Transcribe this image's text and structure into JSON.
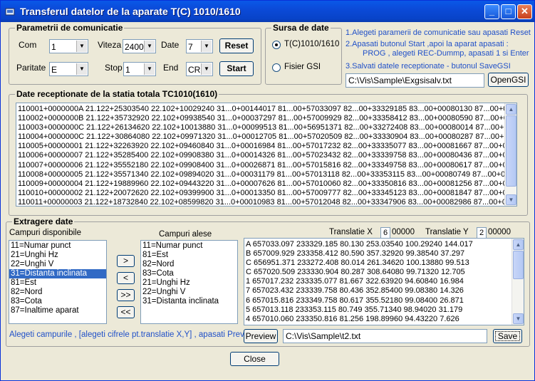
{
  "window": {
    "title": "Transferul datelor de la aparate T(C) 1010/1610",
    "minimize": "_",
    "maximize": "□",
    "close": "✕"
  },
  "comm": {
    "title": "Parametrii de comunicatie",
    "com_label": "Com",
    "com_value": "1",
    "viteza_label": "Viteza",
    "viteza_value": "2400",
    "date_label": "Date",
    "date_value": "7",
    "paritate_label": "Paritate",
    "paritate_value": "E",
    "stop_label": "Stop",
    "stop_value": "1",
    "end_label": "End",
    "end_value": "CR",
    "reset_label": "Reset",
    "start_label": "Start"
  },
  "source": {
    "title": "Sursa de date",
    "option_device": "T(C)1010/1610",
    "option_file": "Fisier GSI",
    "selected": "device"
  },
  "instructions": {
    "step1": "1.Alegeti paramerii de comunicatie sau apasati Reset",
    "step2a": "2.Apasati butonul  Start ,apoi la aparat apasati :",
    "step2b": "PROG  , alegeti REC-Dummp, apasati 1 si Enter",
    "step3": "3.Salvati datele receptionate - butonul SaveGSI"
  },
  "gsi": {
    "path": "C:\\Vis\\Sample\\Exgsisalv.txt",
    "open_label": "OpenGSI"
  },
  "received": {
    "title": "Date receptionate de la statia totala TC1010(1610)",
    "lines": [
      "110001+0000000A 21.122+25303540 22.102+10029240 31...0+00144017 81...00+57033097 82...00+33329185 83...00+00080130 87...00+00001",
      "110002+0000000B 21.122+35732920 22.102+09938540 31...0+00037297 81...00+57009929 82...00+33358412 83...00+00080590 87...00+00001",
      "110003+0000000C 21.122+26134620 22.102+10013880 31...0+00099513 81...00+56951371 82...00+33272408 83...00+00080014 87...00+00001",
      "110004+0000000C 21.122+30864080 22.102+09971320 31...0+00012705 81...00+57020509 82...00+33330904 83...00+00080287 87...00+00001",
      "110005+00000001 21.122+32263920 22.102+09460840 31...0+00016984 81...00+57017232 82...00+33335077 83...00+00081667 87...00+00001",
      "110006+00000007 21.122+35285400 22.102+09908380 31...0+00014326 81...00+57023432 82...00+33339758 83...00+00080436 87...00+00001",
      "110007+00000006 21.122+35552180 22.102+09908400 31...0+00026871 81...00+57015816 82...00+33349758 83...00+00080617 87...00+00001",
      "110008+00000005 21.122+35571340 22.102+09894020 31...0+00031179 81...00+57013118 82...00+33353115 83...00+00080749 87...00+00001",
      "110009+00000004 21.122+19889960 22.102+09443220 31...0+00007626 81...00+57010060 82...00+33350816 83...00+00081256 87...00+00001",
      "110010+00000002 21.122+20072620 22.102+09399900 31...0+00013350 81...00+57009777 82...00+33345123 83...00+00081847 87...00+00001",
      "110011+00000003 21.122+18732840 22.102+08599820 31...0+00010983 81...00+57012048 82...00+33347906 83...00+00082986 87...00+00001"
    ]
  },
  "extract": {
    "title": "Extragere date",
    "available_label": "Campuri disponibile",
    "available": [
      "11=Numar punct",
      "21=Unghi Hz",
      "22=Unghi V",
      "31=Distanta inclinata",
      "81=Est",
      "82=Nord",
      "83=Cota",
      "87=Inaltime aparat"
    ],
    "available_selected": 3,
    "chosen_label": "Campuri alese",
    "chosen": [
      "11=Numar punct",
      "81=Est",
      "82=Nord",
      "83=Cota",
      "21=Unghi Hz",
      "22=Unghi V",
      "31=Distanta inclinata"
    ],
    "move_right": ">",
    "move_left": "<",
    "move_all_right": ">>",
    "move_all_left": "<<",
    "translatie_x_label": "Translatie X",
    "translatie_x_digit": "6",
    "translatie_x_value": "00000",
    "translatie_y_label": "Translatie Y",
    "translatie_y_digit": "2",
    "translatie_y_value": "00000",
    "output_lines": [
      "A 657033.097 233329.185 80.130 253.03540 100.29240 144.017",
      "B 657009.929 233358.412 80.590 357.32920 99.38540 37.297",
      "C 656951.371 233272.408 80.014 261.34620 100.13880 99.513",
      "C 657020.509 233330.904 80.287 308.64080 99.71320 12.705",
      "1 657017.232 233335.077 81.667 322.63920 94.60840 16.984",
      "7 657023.432 233339.758 80.436 352.85400 99.08380 14.326",
      "6 657015.816 233349.758 80.617 355.52180 99.08400 26.871",
      "5 657013.118 233353.115 80.749 355.71340 98.94020 31.179",
      "4 657010.060 233350.816 81.256 198.89960 94.43220 7.626"
    ],
    "hint": "Alegeti campurile , [alegeti cifrele pt.translatie X,Y] , apasati Preview",
    "preview_label": "Preview",
    "output_path": "C:\\Vis\\Sample\\t2.txt",
    "save_label": "Save"
  },
  "footer": {
    "close_label": "Close"
  }
}
